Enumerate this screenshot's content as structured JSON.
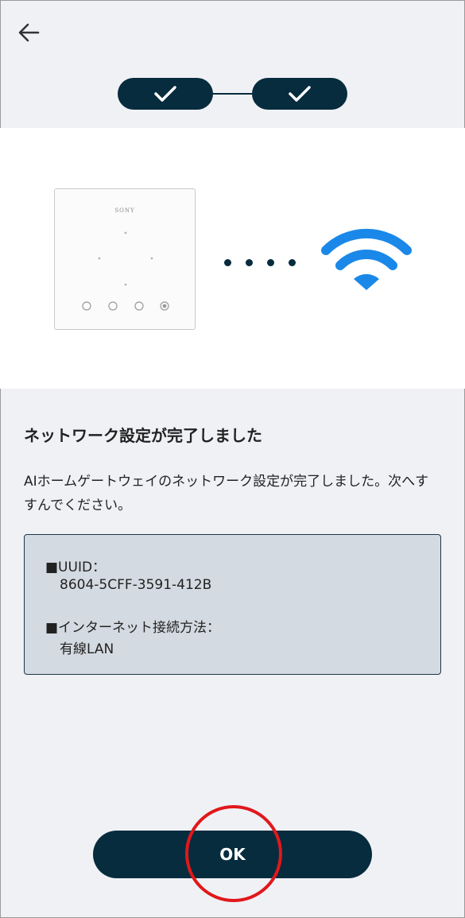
{
  "header": {
    "back_icon": "arrow-left-icon"
  },
  "stepper": {
    "steps": [
      {
        "status": "complete",
        "icon": "check-icon"
      },
      {
        "status": "complete",
        "icon": "check-icon"
      }
    ],
    "color": "#062c3e"
  },
  "illustration": {
    "device_brand": "SONY",
    "connection_icon": "wifi-icon",
    "wifi_color": "#1a88e8"
  },
  "content": {
    "title": "ネットワーク設定が完了しました",
    "description": "AIホームゲートウェイのネットワーク設定が完了しました。次へすすんでください。"
  },
  "info": {
    "uuid_label": "■UUID：",
    "uuid_value": "8604-5CFF-3591-412B",
    "connection_label": "■インターネット接続方法：",
    "connection_value": "有線LAN"
  },
  "actions": {
    "ok_label": "OK"
  },
  "colors": {
    "primary": "#062c3e",
    "background": "#f0f1f5",
    "info_box": "#d4dae1",
    "highlight": "#e0181b"
  }
}
